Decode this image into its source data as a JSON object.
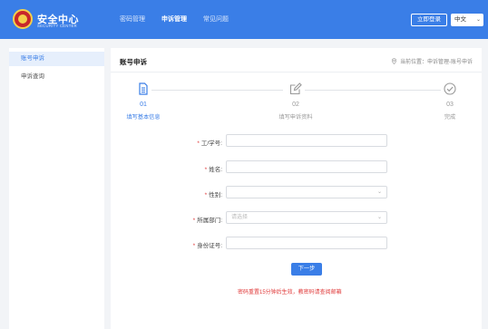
{
  "header": {
    "brand_title": "安全中心",
    "brand_subtitle": "SECURITY CENTER",
    "nav": [
      "密码管理",
      "申诉管理",
      "常见问题"
    ],
    "active_nav": 1,
    "login_label": "立即登录",
    "language": "中文",
    "accent_color": "#3a7ee7"
  },
  "sidebar": {
    "items": [
      {
        "label": "账号申诉",
        "active": true
      },
      {
        "label": "申诉查询",
        "active": false
      }
    ]
  },
  "main": {
    "title": "账号申诉",
    "breadcrumb": "当前位置：申诉管理-账号申诉",
    "steps": [
      {
        "num": "01",
        "label": "填写基本信息",
        "icon": "document-icon",
        "state": "active"
      },
      {
        "num": "02",
        "label": "填写申诉资料",
        "icon": "edit-icon",
        "state": "pending"
      },
      {
        "num": "03",
        "label": "完成",
        "icon": "check-circle-icon",
        "state": "pending"
      }
    ]
  },
  "form": {
    "fields": [
      {
        "label": "工/学号:",
        "type": "text",
        "value": "",
        "placeholder": "",
        "required": true
      },
      {
        "label": "姓名:",
        "type": "text",
        "value": "",
        "placeholder": "",
        "required": true
      },
      {
        "label": "性别:",
        "type": "select",
        "value": "",
        "placeholder": "",
        "required": true
      },
      {
        "label": "所属部门:",
        "type": "select",
        "value": "",
        "placeholder": "请选择",
        "required": true
      },
      {
        "label": "身份证号:",
        "type": "text",
        "value": "",
        "placeholder": "",
        "required": true
      }
    ],
    "next_label": "下一步",
    "notice": "密码重置15分钟后生效，教密码请查阅邮箱"
  }
}
